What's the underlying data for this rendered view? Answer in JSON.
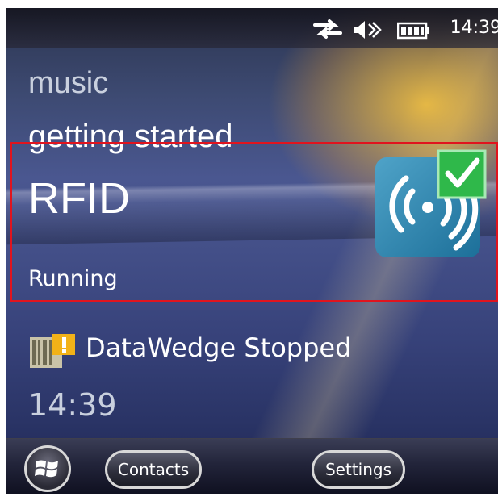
{
  "status_bar": {
    "time": "14:39",
    "icons": [
      "connectivity-icon",
      "volume-icon",
      "battery-icon"
    ]
  },
  "today": {
    "music_label": "music",
    "getting_started_label": "getting started",
    "rfid": {
      "title": "RFID",
      "status": "Running",
      "icon": "rfid-running-icon",
      "highlight_color": "#e0141e"
    },
    "datawedge": {
      "label": "DataWedge Stopped",
      "icon": "datawedge-warning-icon"
    },
    "time": "14:39"
  },
  "taskbar": {
    "start_icon": "windows-start-icon",
    "contacts_label": "Contacts",
    "settings_label": "Settings"
  }
}
